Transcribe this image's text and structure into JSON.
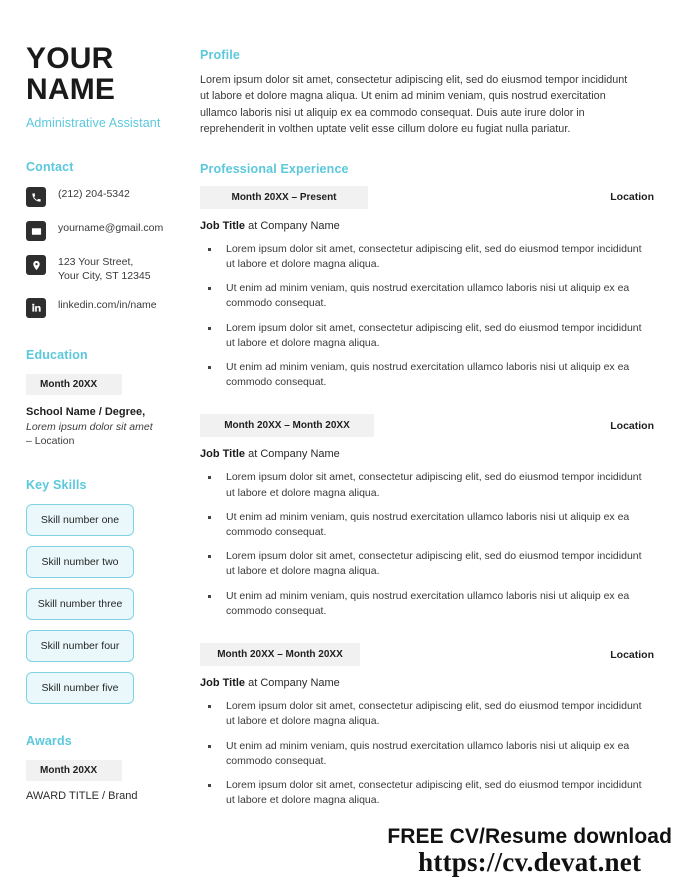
{
  "accent_color": "#5bc8dc",
  "badge_bg": "#f1f1f1",
  "skill_pill_bg": "#eaf8fb",
  "skill_pill_border": "#7ed4e4",
  "sidebar": {
    "name_line1": "YOUR",
    "name_line2": "NAME",
    "job_role": "Administrative Assistant",
    "contact_heading": "Contact",
    "contacts": [
      {
        "icon": "phone-icon",
        "text": "(212) 204-5342"
      },
      {
        "icon": "envelope-icon",
        "text": "yourname@gmail.com"
      },
      {
        "icon": "map-pin-icon",
        "text": "123 Your Street,\nYour City, ST 12345"
      },
      {
        "icon": "linkedin-icon",
        "text": "linkedin.com/in/name"
      }
    ],
    "education_heading": "Education",
    "education": {
      "date": "Month 20XX",
      "school": "School Name / Degree,",
      "description": "Lorem ipsum dolor sit amet",
      "location": "– Location"
    },
    "skills_heading": "Key Skills",
    "skills": [
      "Skill number one",
      "Skill number two",
      "Skill number three",
      "Skill number four",
      "Skill number five"
    ],
    "awards_heading": "Awards",
    "awards": {
      "date": "Month 20XX",
      "title": "AWARD TITLE / Brand"
    }
  },
  "main": {
    "profile_heading": "Profile",
    "profile_text": "Lorem ipsum dolor sit amet, consectetur adipiscing elit, sed do eiusmod tempor incididunt ut labore et dolore magna aliqua. Ut enim ad minim veniam, quis nostrud exercitation ullamco laboris nisi ut aliquip ex ea commodo consequat. Duis aute irure dolor in reprehenderit in volthen uptate velit esse cillum dolore eu fugiat nulla pariatur.",
    "experience_heading": "Professional Experience",
    "experience": [
      {
        "date": "Month 20XX – Present",
        "location": "Location",
        "title_bold": "Job Title",
        "title_rest": " at Company Name",
        "bullets": [
          "Lorem ipsum dolor sit amet, consectetur adipiscing elit, sed do eiusmod tempor incididunt ut labore et dolore magna aliqua.",
          "Ut enim ad minim veniam, quis nostrud exercitation ullamco laboris nisi ut aliquip ex ea commodo consequat.",
          "Lorem ipsum dolor sit amet, consectetur adipiscing elit, sed do eiusmod tempor incididunt ut labore et dolore magna aliqua.",
          "Ut enim ad minim veniam, quis nostrud exercitation ullamco laboris nisi ut aliquip ex ea commodo consequat."
        ]
      },
      {
        "date": "Month 20XX – Month 20XX",
        "location": "Location",
        "title_bold": "Job Title",
        "title_rest": " at Company Name",
        "bullets": [
          "Lorem ipsum dolor sit amet, consectetur adipiscing elit, sed do eiusmod tempor incididunt ut labore et dolore magna aliqua.",
          "Ut enim ad minim veniam, quis nostrud exercitation ullamco laboris nisi ut aliquip ex ea commodo consequat.",
          "Lorem ipsum dolor sit amet, consectetur adipiscing elit, sed do eiusmod tempor incididunt ut labore et dolore magna aliqua.",
          "Ut enim ad minim veniam, quis nostrud exercitation ullamco laboris nisi ut aliquip ex ea commodo consequat."
        ]
      },
      {
        "date": "Month 20XX – Month 20XX",
        "location": "Location",
        "title_bold": "Job Title",
        "title_rest": " at Company Name",
        "bullets": [
          "Lorem ipsum dolor sit amet, consectetur adipiscing elit, sed do eiusmod tempor incididunt ut labore et dolore magna aliqua.",
          "Ut enim ad minim veniam, quis nostrud exercitation ullamco laboris nisi ut aliquip ex ea commodo consequat.",
          "Lorem ipsum dolor sit amet, consectetur adipiscing elit, sed do eiusmod tempor incididunt ut labore et dolore magna aliqua."
        ]
      }
    ]
  },
  "watermark": {
    "line1": "FREE CV/Resume download",
    "line2": "https://cv.devat.net"
  }
}
